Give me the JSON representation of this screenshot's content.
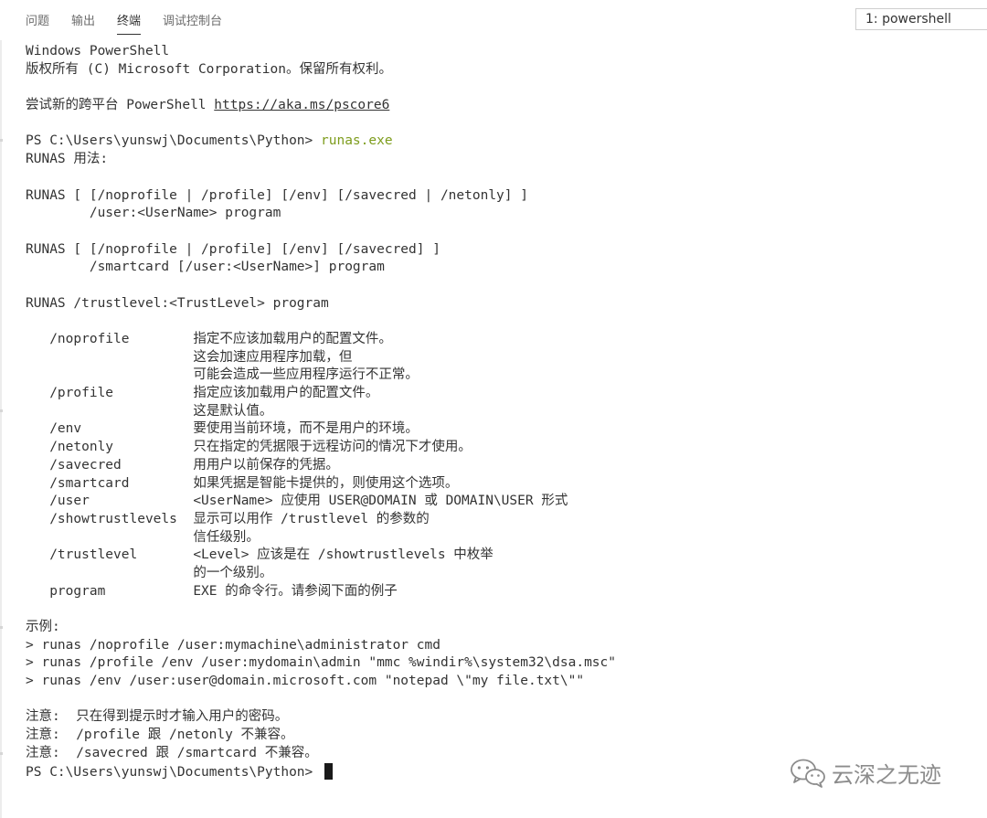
{
  "panel": {
    "tabs": [
      {
        "label": "问题"
      },
      {
        "label": "输出"
      },
      {
        "label": "终端"
      },
      {
        "label": "调试控制台"
      }
    ],
    "active_tab": "终端",
    "terminal_selector": "1: powershell"
  },
  "terminal": {
    "header_line1": "Windows PowerShell",
    "header_line2": "版权所有 (C) Microsoft Corporation。保留所有权利。",
    "try_text": "尝试新的跨平台 PowerShell ",
    "try_link": "https://aka.ms/pscore6",
    "prompt": "PS C:\\Users\\yunswj\\Documents\\Python> ",
    "command": "runas.exe",
    "output_lines": [
      "RUNAS 用法:",
      "",
      "RUNAS [ [/noprofile | /profile] [/env] [/savecred | /netonly] ]",
      "        /user:<UserName> program",
      "",
      "RUNAS [ [/noprofile | /profile] [/env] [/savecred] ]",
      "        /smartcard [/user:<UserName>] program",
      "",
      "RUNAS /trustlevel:<TrustLevel> program",
      "",
      "   /noprofile        指定不应该加载用户的配置文件。",
      "                     这会加速应用程序加载，但",
      "                     可能会造成一些应用程序运行不正常。",
      "   /profile          指定应该加载用户的配置文件。",
      "                     这是默认值。",
      "   /env              要使用当前环境，而不是用户的环境。",
      "   /netonly          只在指定的凭据限于远程访问的情况下才使用。",
      "   /savecred         用用户以前保存的凭据。",
      "   /smartcard        如果凭据是智能卡提供的，则使用这个选项。",
      "   /user             <UserName> 应使用 USER@DOMAIN 或 DOMAIN\\USER 形式",
      "   /showtrustlevels  显示可以用作 /trustlevel 的参数的",
      "                     信任级别。",
      "   /trustlevel       <Level> 应该是在 /showtrustlevels 中枚举",
      "                     的一个级别。",
      "   program           EXE 的命令行。请参阅下面的例子",
      "",
      "示例:",
      "> runas /noprofile /user:mymachine\\administrator cmd",
      "> runas /profile /env /user:mydomain\\admin \"mmc %windir%\\system32\\dsa.msc\"",
      "> runas /env /user:user@domain.microsoft.com \"notepad \\\"my file.txt\\\"\"",
      "",
      "注意:  只在得到提示时才输入用户的密码。",
      "注意:  /profile 跟 /netonly 不兼容。",
      "注意:  /savecred 跟 /smartcard 不兼容。"
    ],
    "final_prompt": "PS C:\\Users\\yunswj\\Documents\\Python> "
  },
  "watermark": {
    "text": "云深之无迹",
    "icon": "wechat-icon"
  }
}
